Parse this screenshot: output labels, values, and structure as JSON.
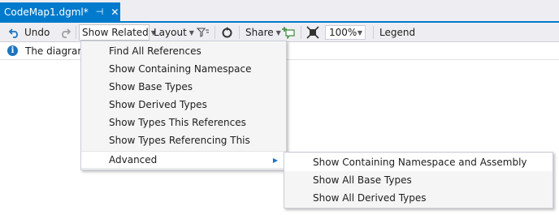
{
  "tab": {
    "title": "CodeMap1.dgml*",
    "pin_glyph": "⊣",
    "close_glyph": "✕"
  },
  "toolbar": {
    "undo_label": "Undo",
    "show_related_label": "Show Related",
    "layout_label": "Layout",
    "share_label": "Share",
    "zoom_value": "100%",
    "legend_label": "Legend"
  },
  "infobar": {
    "icon_glyph": "i",
    "text": "The diagram"
  },
  "menu": {
    "items": [
      "Find All References",
      "Show Containing Namespace",
      "Show Base Types",
      "Show Derived Types",
      "Show Types This References",
      "Show Types Referencing This"
    ],
    "advanced_label": "Advanced"
  },
  "submenu": {
    "items": [
      "Show Containing Namespace and Assembly",
      "Show All Base Types",
      "Show All Derived Types"
    ]
  },
  "colors": {
    "accent": "#007acc",
    "chrome": "#eeeef2",
    "menu_bg": "#f5f5f5"
  }
}
